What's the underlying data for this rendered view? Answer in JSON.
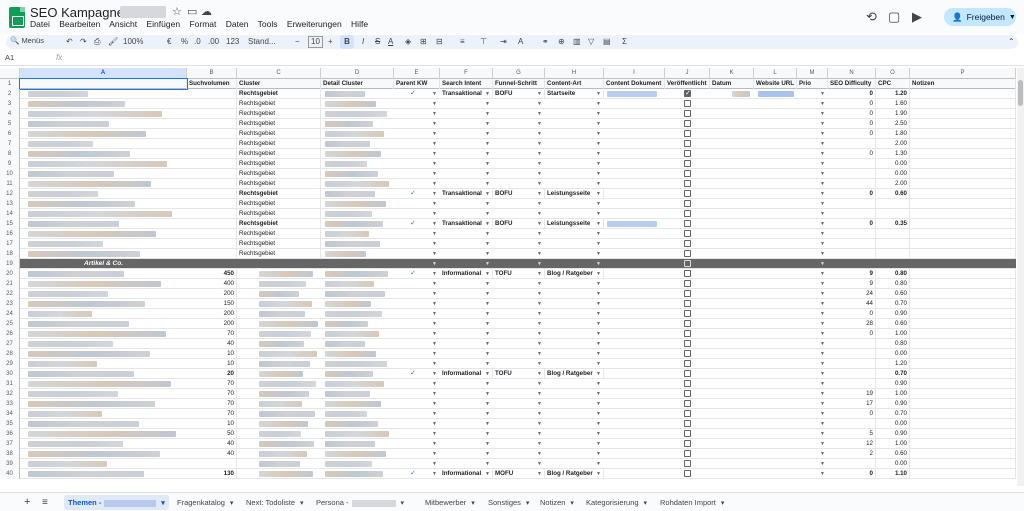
{
  "doc": {
    "title": "SEO Kampagne -"
  },
  "menu": [
    "Datei",
    "Bearbeiten",
    "Ansicht",
    "Einfügen",
    "Format",
    "Daten",
    "Tools",
    "Erweiterungen",
    "Hilfe"
  ],
  "share_label": "Freigeben",
  "toolbar": {
    "menus": "Menüs",
    "zoom": "100%",
    "euro": "€",
    "percent": "%",
    "decimals": ".0",
    "decimals2": ".00",
    "format123": "123",
    "font": "Stand...",
    "fontsize": "10",
    "bold": "B",
    "italic": "I",
    "strike": "S",
    "fontcolor": "A"
  },
  "namebox": "A1",
  "fx": "fx",
  "columns": [
    {
      "letter": "A",
      "header": ""
    },
    {
      "letter": "B",
      "header": "Suchvolumen"
    },
    {
      "letter": "C",
      "header": "Cluster"
    },
    {
      "letter": "D",
      "header": "Detail Cluster"
    },
    {
      "letter": "E",
      "header": "Parent KW"
    },
    {
      "letter": "F",
      "header": "Search Intent"
    },
    {
      "letter": "G",
      "header": "Funnel-Schritt"
    },
    {
      "letter": "H",
      "header": "Content-Art"
    },
    {
      "letter": "I",
      "header": "Content Dokument"
    },
    {
      "letter": "J",
      "header": "Veröffentlicht"
    },
    {
      "letter": "K",
      "header": "Datum"
    },
    {
      "letter": "L",
      "header": "Website URL"
    },
    {
      "letter": "M",
      "header": "Prio"
    },
    {
      "letter": "N",
      "header": "SEO Difficulty"
    },
    {
      "letter": "O",
      "header": "CPC"
    },
    {
      "letter": "P",
      "header": "Notizen"
    }
  ],
  "rows": [
    {
      "n": "2",
      "vol": "",
      "cluster": "Rechtsgebiet",
      "parent": true,
      "intent": "Transaktional",
      "funnel": "BOFU",
      "art": "Startseite",
      "checked": true,
      "diff": "0",
      "cpc": "1.20",
      "bold": true,
      "hasdoc": true
    },
    {
      "n": "3",
      "vol": "",
      "cluster": "Rechtsgebiet",
      "diff": "0",
      "cpc": "1.60"
    },
    {
      "n": "4",
      "vol": "",
      "cluster": "Rechtsgebiet",
      "diff": "0",
      "cpc": "1.90"
    },
    {
      "n": "5",
      "vol": "",
      "cluster": "Rechtsgebiet",
      "diff": "0",
      "cpc": "2.50"
    },
    {
      "n": "6",
      "vol": "",
      "cluster": "Rechtsgebiet",
      "diff": "0",
      "cpc": "1.80"
    },
    {
      "n": "7",
      "vol": "",
      "cluster": "Rechtsgebiet",
      "diff": "",
      "cpc": "2.00"
    },
    {
      "n": "8",
      "vol": "",
      "cluster": "Rechtsgebiet",
      "diff": "0",
      "cpc": "1.30"
    },
    {
      "n": "9",
      "vol": "",
      "cluster": "Rechtsgebiet",
      "diff": "",
      "cpc": "0.00"
    },
    {
      "n": "10",
      "vol": "",
      "cluster": "Rechtsgebiet",
      "diff": "",
      "cpc": "0.00"
    },
    {
      "n": "11",
      "vol": "",
      "cluster": "Rechtsgebiet",
      "diff": "",
      "cpc": "2.00"
    },
    {
      "n": "12",
      "vol": "",
      "cluster": "Rechtsgebiet",
      "parent": true,
      "intent": "Transaktional",
      "funnel": "BOFU",
      "art": "Leistungsseite",
      "diff": "0",
      "cpc": "0.60",
      "bold": true
    },
    {
      "n": "13",
      "vol": "",
      "cluster": "Rechtsgebiet",
      "diff": "",
      "cpc": ""
    },
    {
      "n": "14",
      "vol": "",
      "cluster": "Rechtsgebiet",
      "diff": "",
      "cpc": ""
    },
    {
      "n": "15",
      "vol": "",
      "cluster": "Rechtsgebiet",
      "parent": true,
      "intent": "Transaktional",
      "funnel": "BOFU",
      "art": "Leistungsseite",
      "diff": "0",
      "cpc": "0.35",
      "bold": true,
      "hasdoc": true
    },
    {
      "n": "16",
      "vol": "",
      "cluster": "Rechtsgebiet",
      "diff": "",
      "cpc": ""
    },
    {
      "n": "17",
      "vol": "",
      "cluster": "Rechtsgebiet",
      "diff": "",
      "cpc": ""
    },
    {
      "n": "18",
      "vol": "",
      "cluster": "Rechtsgebiet",
      "diff": "",
      "cpc": ""
    },
    {
      "n": "19",
      "section": "Artikel & Co."
    },
    {
      "n": "20",
      "vol": "450",
      "cluster": "",
      "parent": true,
      "intent": "Informational",
      "funnel": "TOFU",
      "art": "Blog / Ratgeber",
      "diff": "9",
      "cpc": "0.80",
      "bold": true
    },
    {
      "n": "21",
      "vol": "400",
      "diff": "9",
      "cpc": "0.80"
    },
    {
      "n": "22",
      "vol": "200",
      "diff": "24",
      "cpc": "0.60"
    },
    {
      "n": "23",
      "vol": "150",
      "diff": "44",
      "cpc": "0.70"
    },
    {
      "n": "24",
      "vol": "200",
      "diff": "0",
      "cpc": "0.90"
    },
    {
      "n": "25",
      "vol": "200",
      "diff": "28",
      "cpc": "0.60"
    },
    {
      "n": "26",
      "vol": "70",
      "diff": "0",
      "cpc": "1.00"
    },
    {
      "n": "27",
      "vol": "40",
      "diff": "",
      "cpc": "0.80"
    },
    {
      "n": "28",
      "vol": "10",
      "diff": "",
      "cpc": "0.00"
    },
    {
      "n": "29",
      "vol": "10",
      "diff": "",
      "cpc": "1.20"
    },
    {
      "n": "30",
      "vol": "20",
      "parent": true,
      "intent": "Informational",
      "funnel": "TOFU",
      "art": "Blog / Ratgeber",
      "diff": "",
      "cpc": "0.70",
      "bold": true
    },
    {
      "n": "31",
      "vol": "70",
      "diff": "",
      "cpc": "0.90"
    },
    {
      "n": "32",
      "vol": "70",
      "diff": "19",
      "cpc": "1.00"
    },
    {
      "n": "33",
      "vol": "70",
      "diff": "17",
      "cpc": "0.90"
    },
    {
      "n": "34",
      "vol": "70",
      "diff": "0",
      "cpc": "0.70"
    },
    {
      "n": "35",
      "vol": "10",
      "diff": "",
      "cpc": "0.00"
    },
    {
      "n": "36",
      "vol": "50",
      "diff": "5",
      "cpc": "0.90"
    },
    {
      "n": "37",
      "vol": "40",
      "diff": "12",
      "cpc": "1.00"
    },
    {
      "n": "38",
      "vol": "40",
      "diff": "2",
      "cpc": "0.60"
    },
    {
      "n": "39",
      "vol": "",
      "diff": "",
      "cpc": "0.00"
    },
    {
      "n": "40",
      "vol": "130",
      "parent": true,
      "intent": "Informational",
      "funnel": "MOFU",
      "art": "Blog / Ratgeber",
      "diff": "0",
      "cpc": "1.10",
      "bold": true
    }
  ],
  "tabs": [
    {
      "label": "Themen -",
      "active": true
    },
    {
      "label": "Fragenkatalog"
    },
    {
      "label": "Next: Todoliste"
    },
    {
      "label": "Persona -"
    },
    {
      "label": "Mitbewerber"
    },
    {
      "label": "Sonstiges"
    },
    {
      "label": "Notizen"
    },
    {
      "label": "Kategorisierung"
    },
    {
      "label": "Rohdaten Import"
    }
  ],
  "icons": {
    "star": "star-icon",
    "folder": "folder-icon",
    "cloud": "cloud-icon",
    "history": "history-icon",
    "comment": "comment-icon",
    "meet": "video-icon",
    "person": "person-icon"
  }
}
